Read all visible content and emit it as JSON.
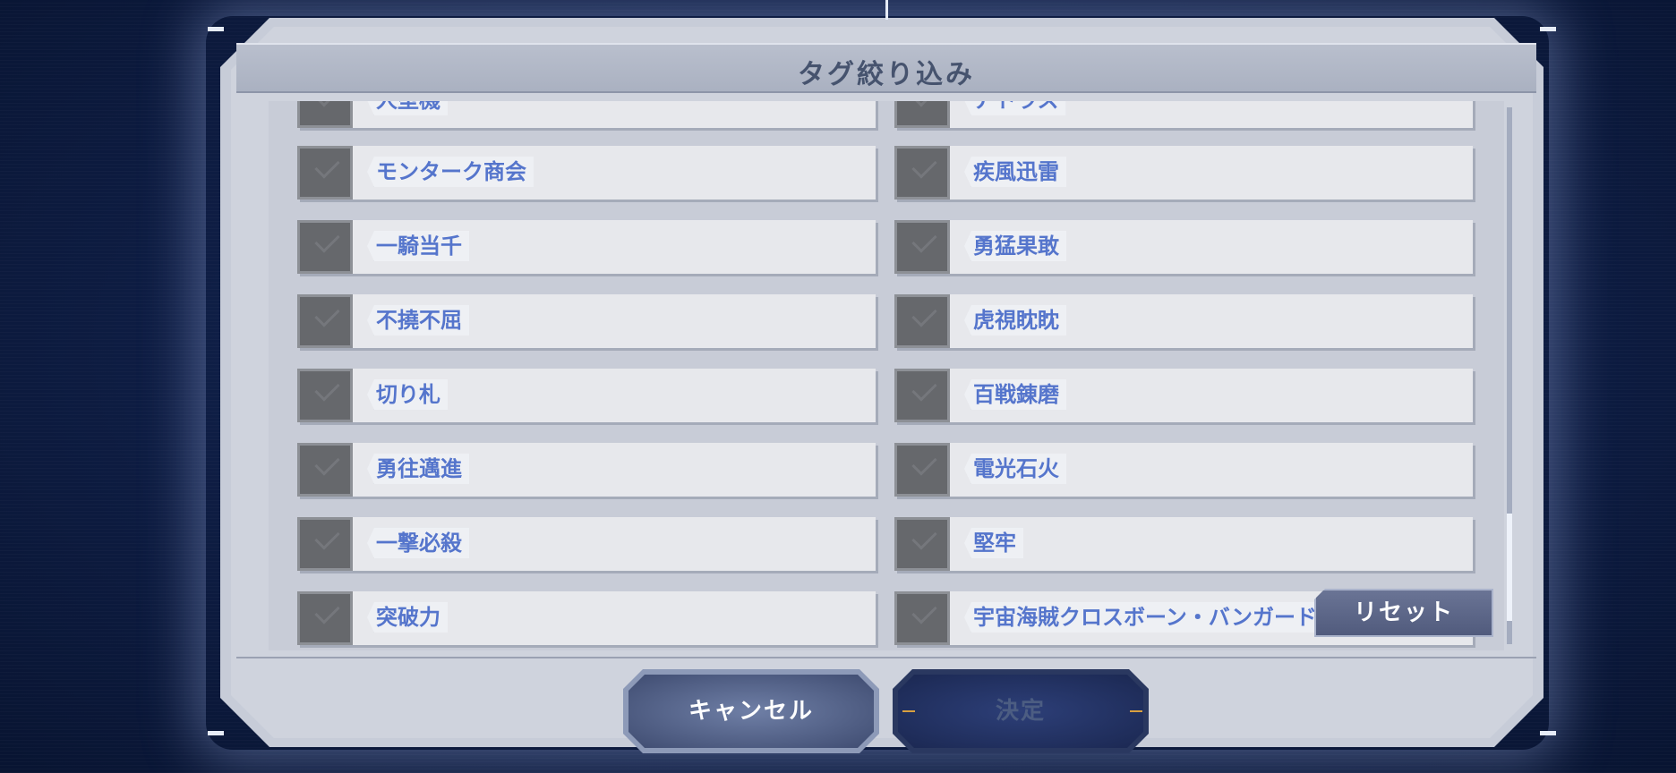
{
  "dialog": {
    "title": "タグ絞り込み"
  },
  "tags": [
    {
      "left": "人型機",
      "right": "アトラス"
    },
    {
      "left": "モンターク商会",
      "right": "疾風迅雷"
    },
    {
      "left": "一騎当千",
      "right": "勇猛果敢"
    },
    {
      "left": "不撓不屈",
      "right": "虎視眈眈"
    },
    {
      "left": "切り札",
      "right": "百戦錬磨"
    },
    {
      "left": "勇往邁進",
      "right": "電光石火"
    },
    {
      "left": "一撃必殺",
      "right": "堅牢"
    },
    {
      "left": "突破力",
      "right": "宇宙海賊クロスボーン・バンガード"
    }
  ],
  "buttons": {
    "reset": "リセット",
    "cancel": "キャンセル",
    "confirm": "決定"
  },
  "colors": {
    "accent_text": "#5575cc",
    "background": "#0e1d44",
    "panel": "#c8ccd7"
  }
}
